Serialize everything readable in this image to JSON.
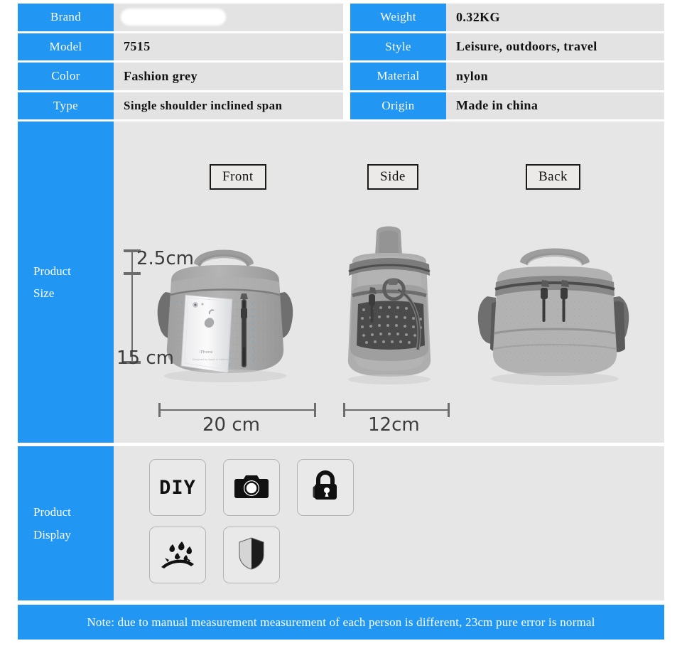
{
  "spec_table": {
    "rows": [
      {
        "label_left": "Brand",
        "value_left": "",
        "left_redacted": true,
        "label_right": "Weight",
        "value_right": "0.32KG"
      },
      {
        "label_left": "Model",
        "value_left": "7515",
        "label_right": "Style",
        "value_right": "Leisure, outdoors, travel"
      },
      {
        "label_left": "Color",
        "value_left": "Fashion grey",
        "label_right": "Material",
        "value_right": "nylon"
      },
      {
        "label_left": "Type",
        "value_left": "Single shoulder inclined span",
        "label_right": "Origin",
        "value_right": "Made in china"
      }
    ]
  },
  "size_section": {
    "side_label_line1": "Product",
    "side_label_line2": "Size",
    "views": [
      {
        "name": "Front"
      },
      {
        "name": "Side"
      },
      {
        "name": "Back"
      }
    ],
    "dimensions": {
      "height_top": "2.5cm",
      "height_main": "15 cm",
      "width_front": "20 cm",
      "width_side": "12cm"
    }
  },
  "display_section": {
    "side_label_line1": "Product",
    "side_label_line2": "Display",
    "icons": [
      {
        "name": "diy-icon",
        "text": "DIY"
      },
      {
        "name": "camera-icon",
        "text": ""
      },
      {
        "name": "lock-icon",
        "text": ""
      },
      {
        "name": "waterproof-icon",
        "text": ""
      },
      {
        "name": "shield-icon",
        "text": ""
      }
    ]
  },
  "footer": {
    "note": "Note: due to manual measurement measurement of each person is different, 23cm pure error is normal"
  },
  "colors": {
    "brand_blue": "#2196f3",
    "panel_grey": "#e6e6e6",
    "cell_grey": "#e3e3e3"
  }
}
